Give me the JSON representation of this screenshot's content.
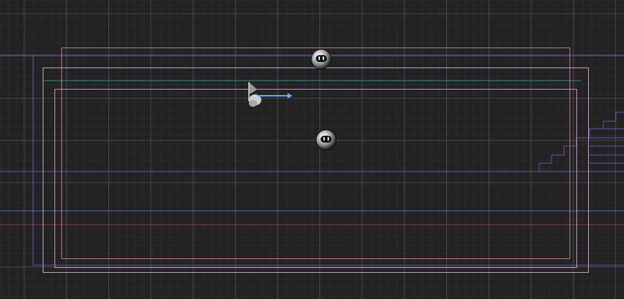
{
  "scene": {
    "background": "#222222",
    "colors": {
      "outer_frame": "#c77b86",
      "inner_frame": "#c99ac7",
      "middle_frame": "#c8a6cf",
      "blue_guides": "#5c5cc0",
      "red_guide": "#9e2b3d",
      "teal_guide": "#2b9a92",
      "arrow": "#6ab0ff"
    },
    "objects": {
      "player_icon": "player-start-flag-icon",
      "pickup_icon": "orb-sprite-icon"
    }
  }
}
